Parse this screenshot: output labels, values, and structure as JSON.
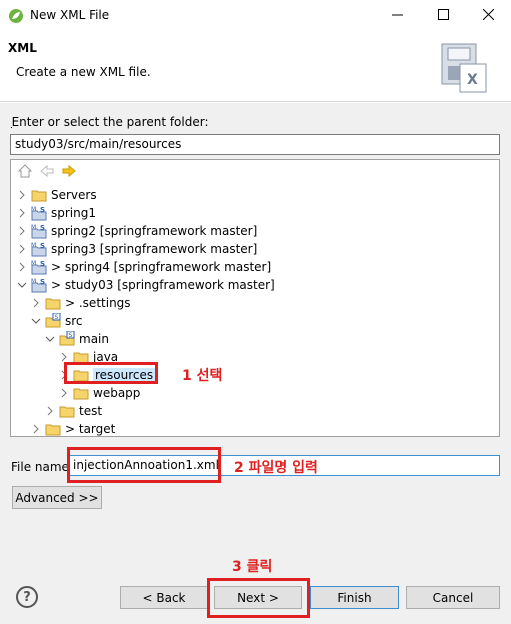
{
  "window": {
    "title": "New XML File",
    "icons": {
      "app": "spring-leaf-icon",
      "minimize": "minimize-icon",
      "maximize": "maximize-icon",
      "close": "close-icon"
    }
  },
  "banner": {
    "heading": "XML",
    "description": "Create a new XML file.",
    "image": "xml-wizard-icon"
  },
  "parent_folder": {
    "label": "Enter or select the parent folder:",
    "value": "study03/src/main/resources"
  },
  "tree": {
    "nav_icons": [
      "home-icon",
      "back-arrow-icon",
      "forward-arrow-icon"
    ],
    "items": [
      {
        "label": "Servers",
        "icon": "folder-icon",
        "expanded": false
      },
      {
        "label": "spring1",
        "icon": "spring-project-icon",
        "expanded": false
      },
      {
        "label": "spring2 [springframework master]",
        "icon": "spring-project-icon",
        "expanded": false
      },
      {
        "label": "spring3 [springframework master]",
        "icon": "spring-project-icon",
        "expanded": false
      },
      {
        "label": "> spring4 [springframework master]",
        "icon": "spring-project-icon",
        "expanded": false
      },
      {
        "label": "> study03 [springframework master]",
        "icon": "spring-project-icon",
        "expanded": true
      },
      {
        "label": "> .settings",
        "icon": "folder-icon",
        "expanded": false
      },
      {
        "label": "src",
        "icon": "source-folder-icon",
        "expanded": true
      },
      {
        "label": "main",
        "icon": "source-folder-icon",
        "expanded": true
      },
      {
        "label": "java",
        "icon": "folder-icon",
        "expanded": false
      },
      {
        "label": "resources",
        "icon": "folder-icon",
        "expanded": false,
        "selected": true
      },
      {
        "label": "webapp",
        "icon": "folder-icon",
        "expanded": false
      },
      {
        "label": "test",
        "icon": "folder-icon",
        "expanded": false
      },
      {
        "label": "> target",
        "icon": "folder-icon",
        "expanded": false
      }
    ]
  },
  "file_name": {
    "label": "File name:",
    "value": "injectionAnnoation1.xml"
  },
  "advanced_label": "Advanced >>",
  "buttons": {
    "back": "< Back",
    "next": "Next >",
    "finish": "Finish",
    "cancel": "Cancel",
    "help": "?"
  },
  "annotations": {
    "step1": "1 선택",
    "step2": "2 파일명 입력",
    "step3": "3 클릭",
    "color": "#e02020"
  }
}
